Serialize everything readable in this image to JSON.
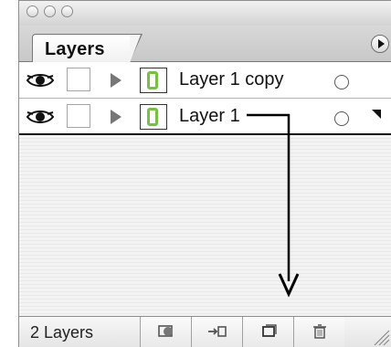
{
  "panel": {
    "tab_label": "Layers",
    "layers": [
      {
        "name": "Layer 1 copy"
      },
      {
        "name": "Layer 1"
      }
    ],
    "footer_count": "2 Layers"
  },
  "colors": {
    "thumbnail_green": "#76c043"
  },
  "icons": {
    "visibility": "eye-icon",
    "expand": "disclosure-triangle-icon",
    "target": "target-circle-icon",
    "menu": "panel-menu-icon",
    "footer": [
      "make-clipping-mask-icon",
      "locate-object-icon",
      "new-layer-icon",
      "delete-icon"
    ]
  }
}
